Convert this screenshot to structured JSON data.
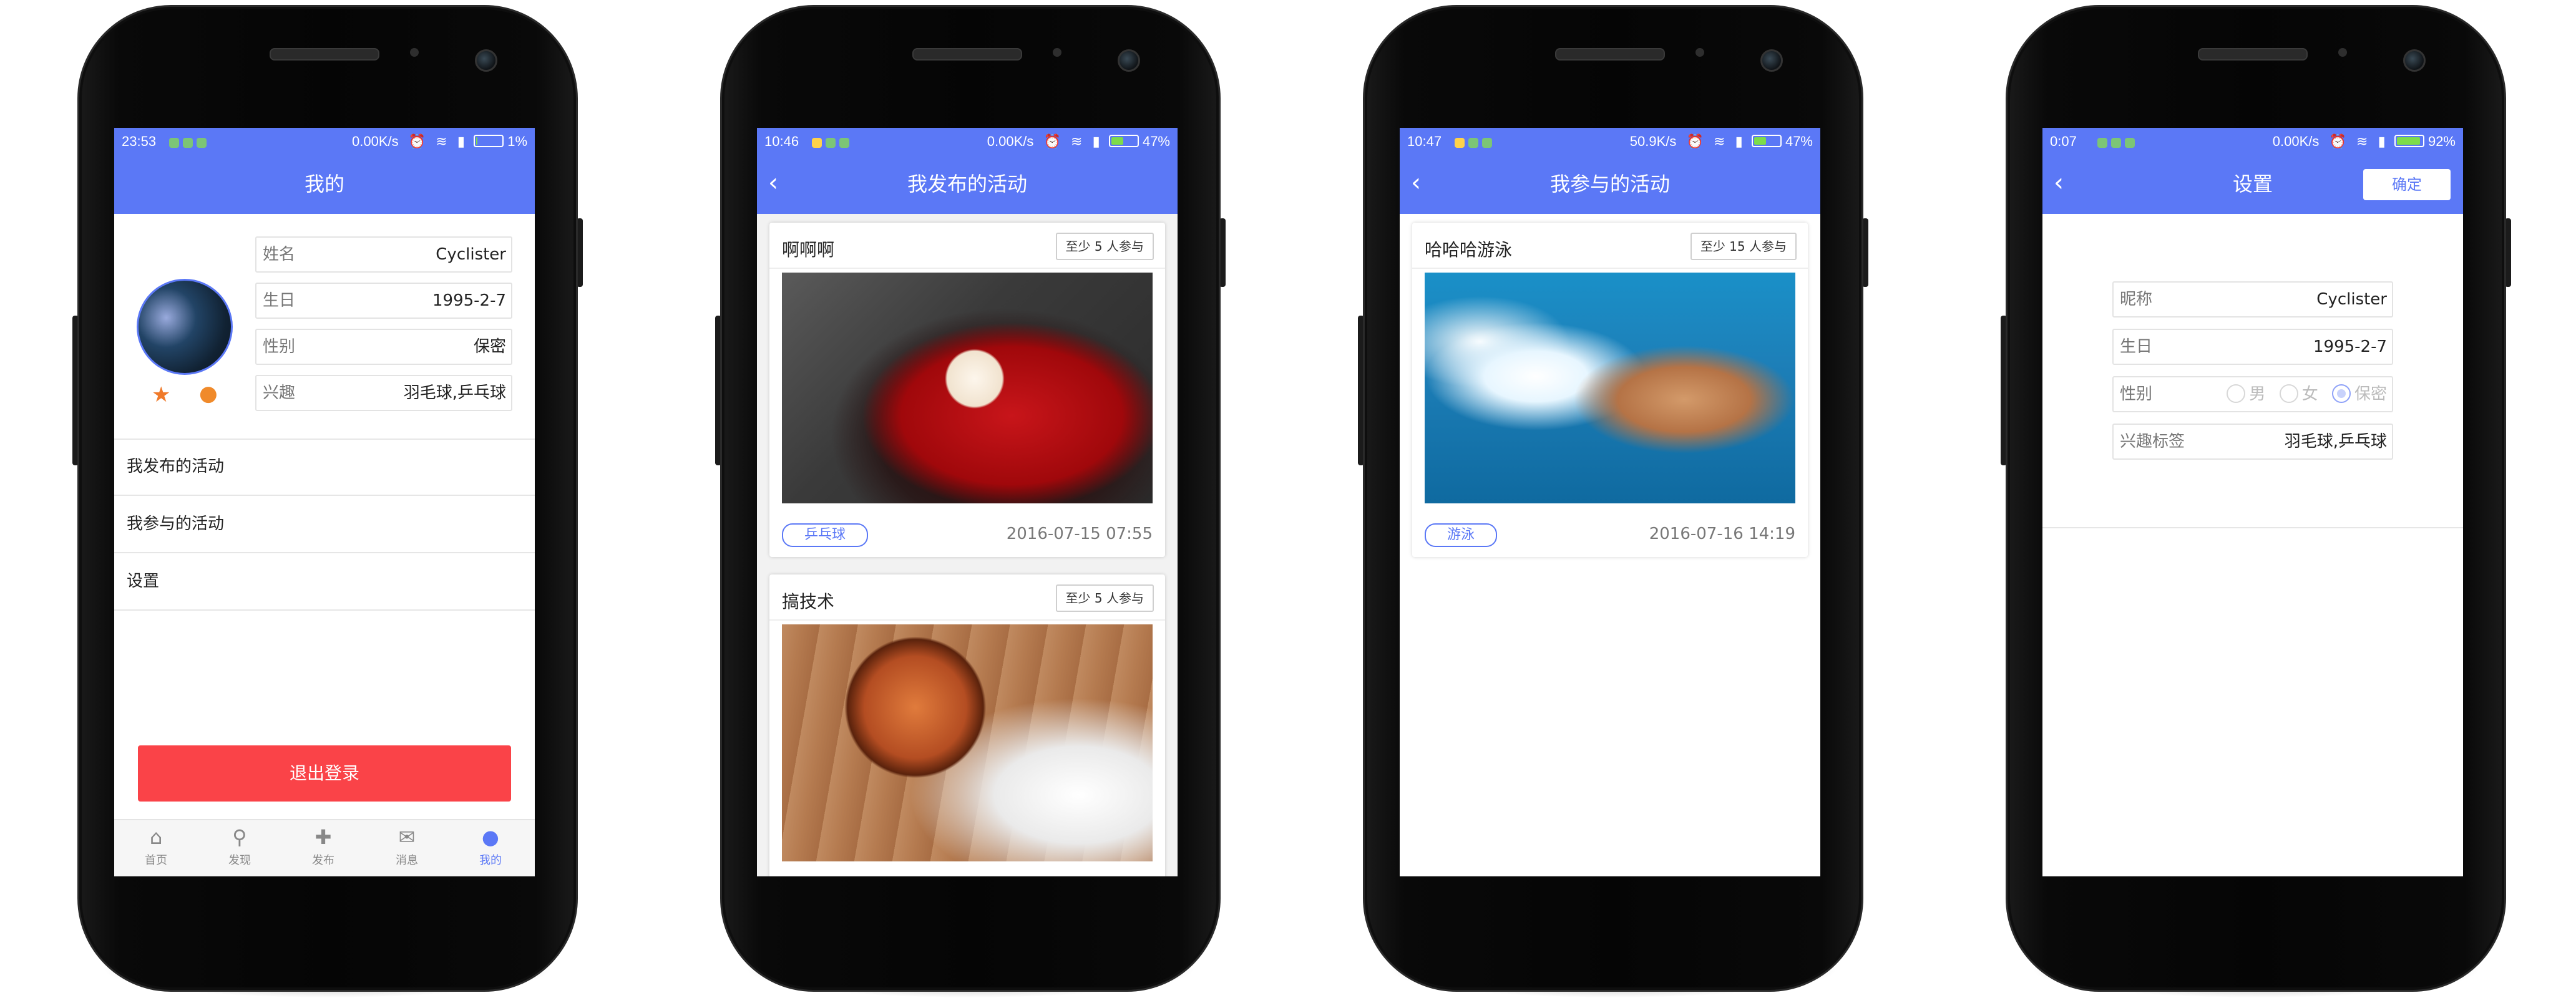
{
  "phones": [
    {
      "status": {
        "time": "23:53",
        "speed": "0.00K/s",
        "battery": "1%",
        "battery_level": 0.01
      },
      "title": "我的",
      "profile": {
        "fields": [
          {
            "label": "姓名",
            "value": "Cyclister"
          },
          {
            "label": "生日",
            "value": "1995-2-7"
          },
          {
            "label": "性别",
            "value": "保密"
          },
          {
            "label": "兴趣",
            "value": "羽毛球,乒乓球"
          }
        ]
      },
      "menu": [
        "我发布的活动",
        "我参与的活动",
        "设置"
      ],
      "logout_label": "退出登录",
      "tabs": [
        {
          "label": "首页",
          "icon": "home-icon"
        },
        {
          "label": "发现",
          "icon": "search-icon"
        },
        {
          "label": "发布",
          "icon": "plus-icon"
        },
        {
          "label": "消息",
          "icon": "mail-icon"
        },
        {
          "label": "我的",
          "icon": "user-icon",
          "active": true
        }
      ]
    },
    {
      "status": {
        "time": "10:46",
        "speed": "0.00K/s",
        "battery": "47%",
        "battery_level": 0.47
      },
      "title": "我发布的活动",
      "cards": [
        {
          "title": "啊啊啊",
          "min_people": "至少 5 人参与",
          "tag": "乒乓球",
          "time": "2016-07-15 07:55"
        },
        {
          "title": "搞技术",
          "min_people": "至少 5 人参与"
        }
      ]
    },
    {
      "status": {
        "time": "10:47",
        "speed": "50.9K/s",
        "battery": "47%",
        "battery_level": 0.47
      },
      "title": "我参与的活动",
      "cards": [
        {
          "title": "哈哈哈游泳",
          "min_people": "至少 15 人参与",
          "tag": "游泳",
          "time": "2016-07-16 14:19"
        }
      ]
    },
    {
      "status": {
        "time": "0:07",
        "speed": "0.00K/s",
        "battery": "92%",
        "battery_level": 0.92
      },
      "title": "设置",
      "confirm_label": "确定",
      "fields": [
        {
          "label": "昵称",
          "value": "Cyclister"
        },
        {
          "label": "生日",
          "value": "1995-2-7"
        },
        {
          "label": "性别",
          "options": [
            "男",
            "女",
            "保密"
          ],
          "selected": "保密"
        },
        {
          "label": "兴趣标签",
          "value": "羽毛球,乒乓球"
        }
      ]
    }
  ],
  "colors": {
    "accent": "#5b78f6",
    "logout": "#fa4348"
  }
}
